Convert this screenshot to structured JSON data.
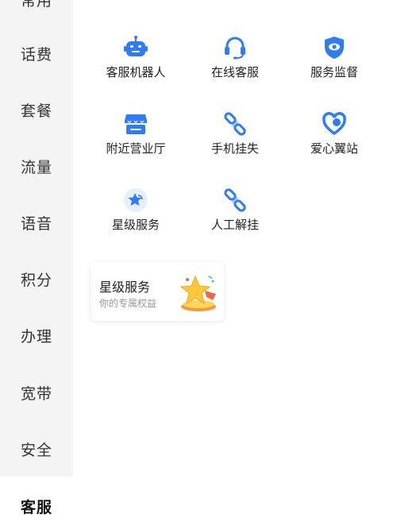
{
  "sidebar": {
    "items": [
      {
        "label": "常用"
      },
      {
        "label": "话费"
      },
      {
        "label": "套餐"
      },
      {
        "label": "流量"
      },
      {
        "label": "语音"
      },
      {
        "label": "积分"
      },
      {
        "label": "办理"
      },
      {
        "label": "宽带"
      },
      {
        "label": "安全"
      }
    ],
    "active": {
      "label": "客服"
    }
  },
  "services": [
    {
      "label": "客服机器人",
      "icon": "robot-icon"
    },
    {
      "label": "在线客服",
      "icon": "headset-icon"
    },
    {
      "label": "服务监督",
      "icon": "shield-eye-icon"
    },
    {
      "label": "附近营业厅",
      "icon": "store-icon"
    },
    {
      "label": "手机挂失",
      "icon": "link-broken-icon"
    },
    {
      "label": "爱心翼站",
      "icon": "heart-icon"
    },
    {
      "label": "星级服务",
      "icon": "star-badge-icon"
    },
    {
      "label": "人工解挂",
      "icon": "link-broken-icon"
    }
  ],
  "star_card": {
    "title": "星级服务",
    "subtitle": "你的专属权益"
  },
  "colors": {
    "accent": "#2f7cf6",
    "sidebar_bg": "#f4f4f4"
  }
}
